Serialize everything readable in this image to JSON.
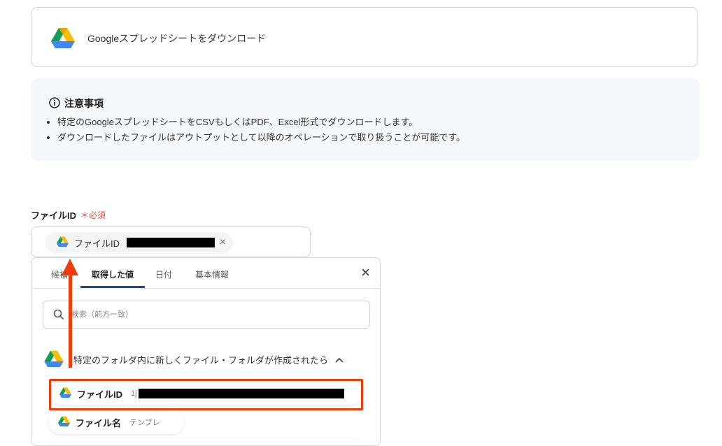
{
  "action": {
    "title": "Googleスプレッドシートをダウンロード",
    "icon": "google-drive-icon"
  },
  "notice": {
    "heading": "注意事項",
    "icon": "info-icon",
    "items": [
      "特定のGoogleスプレッドシートをCSVもしくはPDF、Excel形式でダウンロードします。",
      "ダウンロードしたファイルはアウトプットとして以降のオペレーションで取り扱うことが可能です。"
    ]
  },
  "field": {
    "label": "ファイルID",
    "required_mark": "＊",
    "required_text": "必須",
    "chip_label": "ファイルID",
    "chip_close": "×"
  },
  "popover": {
    "tabs": [
      "候補",
      "取得した値",
      "日付",
      "基本情報"
    ],
    "active_tab": "取得した値",
    "close": "×",
    "search_placeholder": "検索（前方一致）",
    "trigger_text": "特定のフォルダ内に新しくファイル・フォルダが作成されたら",
    "items": [
      {
        "label": "ファイルID",
        "value": "1j"
      },
      {
        "label": "ファイル名",
        "value": "テンプレ"
      }
    ]
  },
  "colors": {
    "accent": "#f03c0a",
    "tab_underline": "#1f4e79",
    "required": "#e25a4a"
  }
}
